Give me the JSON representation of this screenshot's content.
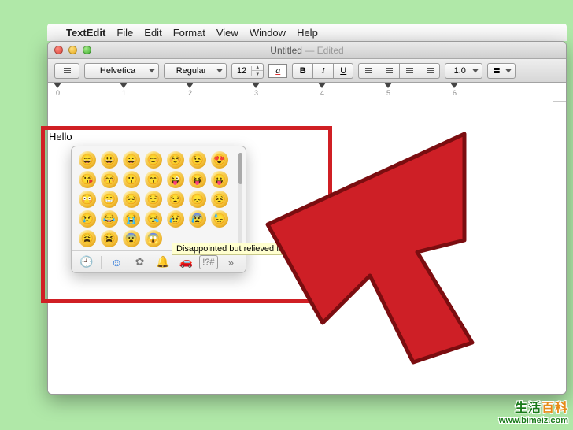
{
  "menubar": {
    "app": "TextEdit",
    "items": [
      "File",
      "Edit",
      "Format",
      "View",
      "Window",
      "Help"
    ]
  },
  "window": {
    "title": "Untitled",
    "state": "Edited"
  },
  "toolbar": {
    "font_family": "Helvetica",
    "font_style": "Regular",
    "font_size": "12",
    "bold": "B",
    "italic": "I",
    "underline": "U",
    "line_spacing": "1.0"
  },
  "ruler": {
    "marks": [
      "0",
      "1",
      "2",
      "3",
      "4",
      "5",
      "6"
    ]
  },
  "document": {
    "text": "Hello"
  },
  "emoji_popover": {
    "tooltip": "Disappointed but relieved face",
    "rows": 5,
    "cols": 7,
    "tabs": {
      "recent": "recent-icon",
      "smileys": "smiley-icon",
      "nature": "flower-icon",
      "objects": "bell-icon",
      "travel": "car-icon",
      "symbols": "symbols-icon",
      "more": "more-icon"
    }
  },
  "watermark": {
    "line1a": "生活",
    "line1b": "百科",
    "url": "www.bimeiz.com"
  }
}
